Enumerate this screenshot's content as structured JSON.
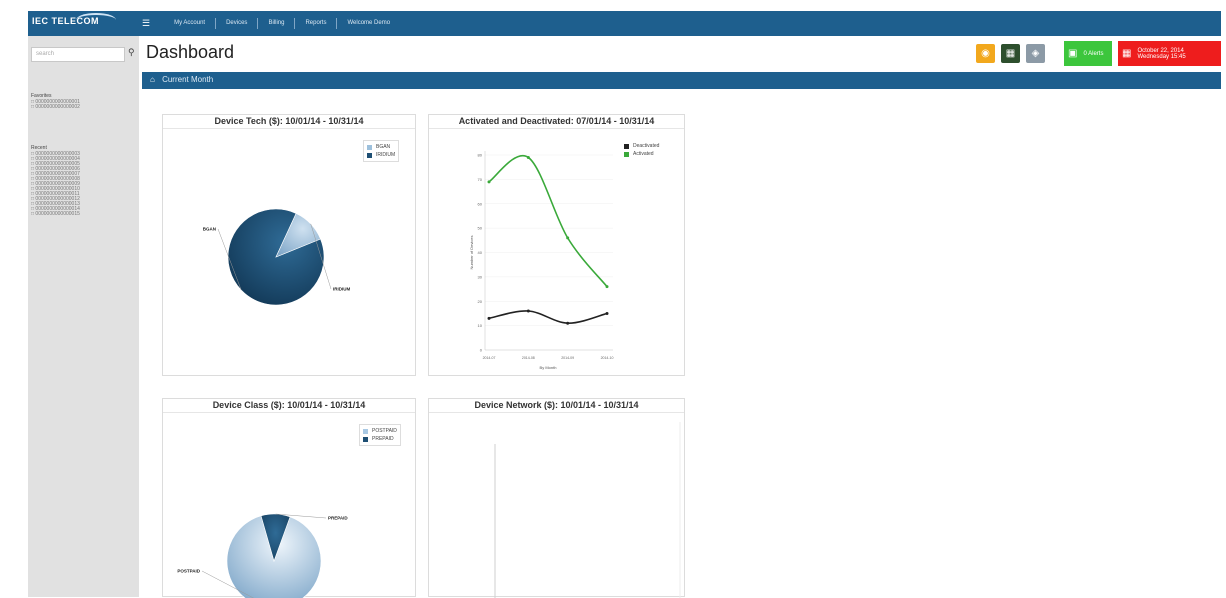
{
  "app": {
    "logo": "IEC TELECOM"
  },
  "nav": {
    "items": [
      "My Account",
      "Devices",
      "Billing",
      "Reports",
      "Welcome Demo"
    ]
  },
  "sidebar": {
    "search_placeholder": "search",
    "favorites_title": "Favorites",
    "favorites": [
      "0000000000000001",
      "0000000000000002"
    ],
    "recent_title": "Recent",
    "recent": [
      "0000000000000003",
      "0000000000000004",
      "0000000000000005",
      "0000000000000006",
      "0000000000000007",
      "0000000000000008",
      "0000000000000009",
      "0000000000000010",
      "0000000000000011",
      "0000000000000012",
      "0000000000000013",
      "0000000000000014",
      "0000000000000015"
    ]
  },
  "page": {
    "title": "Dashboard",
    "section": "Current Month"
  },
  "toolbar": {
    "green_label": "0 Alerts",
    "date_label": "October 22, 2014",
    "day_label": "Wednesday 15:45",
    "colors": {
      "orange": "#f2a81d",
      "dark": "#2d4f2d",
      "grey": "#8c9aa6",
      "green": "#3cc63c",
      "red": "#ee1d1d"
    }
  },
  "panels": {
    "tech_title": "Device Tech ($): 10/01/14 - 10/31/14",
    "activated_title": "Activated and Deactivated: 07/01/14 - 10/31/14",
    "class_title": "Device Class ($): 10/01/14 - 10/31/14",
    "network_title": "Device Network ($): 10/01/14 - 10/31/14"
  },
  "chart_data": [
    {
      "type": "pie",
      "title": "Device Tech ($): 10/01/14 - 10/31/14",
      "categories": [
        "BGAN",
        "IRIDIUM"
      ],
      "values": [
        88,
        12
      ],
      "legend": "top-right",
      "colors": [
        "#1e4f74",
        "#9dc0dc"
      ]
    },
    {
      "type": "line",
      "title": "Activated and Deactivated: 07/01/14 - 10/31/14",
      "x": [
        "2014-07",
        "2014-08",
        "2014-09",
        "2014-10"
      ],
      "xlabel": "By Month",
      "ylabel": "Number of Devices",
      "ylim": [
        0,
        80
      ],
      "yticks": [
        0,
        10,
        20,
        30,
        40,
        50,
        60,
        70,
        80
      ],
      "legend": "top-right",
      "series": [
        {
          "name": "Deactivated",
          "values": [
            13,
            16,
            11,
            15
          ],
          "color": "#222222"
        },
        {
          "name": "Activated",
          "values": [
            69,
            79,
            46,
            26
          ],
          "color": "#3aa93a"
        }
      ]
    },
    {
      "type": "pie",
      "title": "Device Class ($): 10/01/14 - 10/31/14",
      "categories": [
        "POSTPAID",
        "PREPAID"
      ],
      "values": [
        90,
        10
      ],
      "legend": "top-right",
      "colors": [
        "#a9c9e4",
        "#1e4f74"
      ]
    },
    {
      "type": "bar",
      "title": "Device Network ($): 10/01/14 - 10/31/14",
      "categories": [],
      "values": []
    }
  ]
}
